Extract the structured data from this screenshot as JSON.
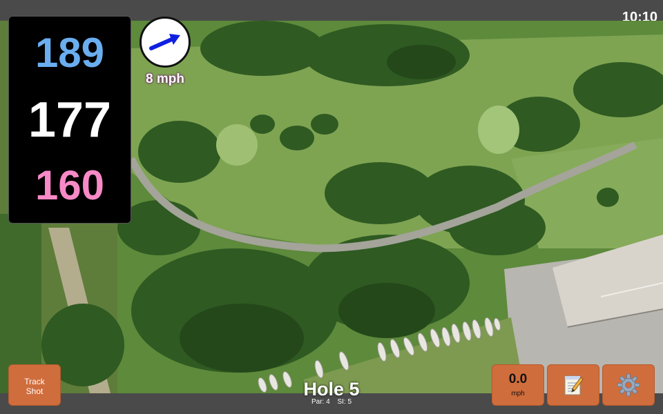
{
  "status": {
    "time": "10:10"
  },
  "distances": {
    "back": "189",
    "middle": "177",
    "front": "160"
  },
  "wind": {
    "speed": "8 mph",
    "icon": "wind-arrow-icon"
  },
  "hole": {
    "title": "Hole 5",
    "par": "Par: 4",
    "si": "SI: 5"
  },
  "buttons": {
    "track_line1": "Track",
    "track_line2": "Shot",
    "speed_value": "0.0",
    "speed_unit": "mph",
    "notes_icon": "notepad-icon",
    "settings_icon": "gear-icon"
  },
  "colors": {
    "back_distance": "#6aaef0",
    "middle_distance": "#ffffff",
    "front_distance": "#f78ac6",
    "button": "#d06d3c",
    "wind_arrow": "#1020e0"
  }
}
